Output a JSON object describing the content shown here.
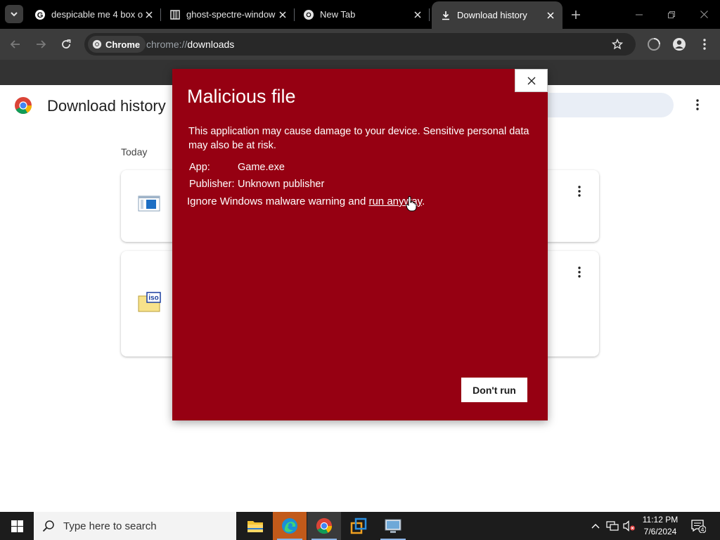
{
  "browser": {
    "tabs": [
      {
        "title": "despicable me 4 box o",
        "icon": "google-g-icon"
      },
      {
        "title": "ghost-spectre-window",
        "icon": "archive-icon"
      },
      {
        "title": "New Tab",
        "icon": "chrome-icon"
      },
      {
        "title": "Download history",
        "icon": "download-icon"
      }
    ],
    "omnibox": {
      "chip_label": "Chrome",
      "url_scheme": "chrome://",
      "url_path": "downloads"
    }
  },
  "page": {
    "title": "Download history",
    "date_group": "Today",
    "items": [
      {
        "icon": "exe-file-icon"
      },
      {
        "icon": "iso-file-icon",
        "badge": "iso"
      }
    ]
  },
  "dialog": {
    "title": "Malicious file",
    "message": "This application may cause damage to your device. Sensitive personal data may also be at risk.",
    "app_label": "App:",
    "app_value": "Game.exe",
    "publisher_label": "Publisher:",
    "publisher_value": "Unknown publisher",
    "warning_prefix": "Ignore Windows malware warning and ",
    "warning_link": "run anyway",
    "warning_suffix": ".",
    "dont_run_label": "Don't run"
  },
  "taskbar": {
    "search_placeholder": "Type here to search",
    "time": "11:12 PM",
    "date": "7/6/2024",
    "notification_count": "4"
  },
  "colors": {
    "dialog_bg": "#960012",
    "tab_active": "#3c3c3c",
    "page_bg": "#ffffff"
  }
}
